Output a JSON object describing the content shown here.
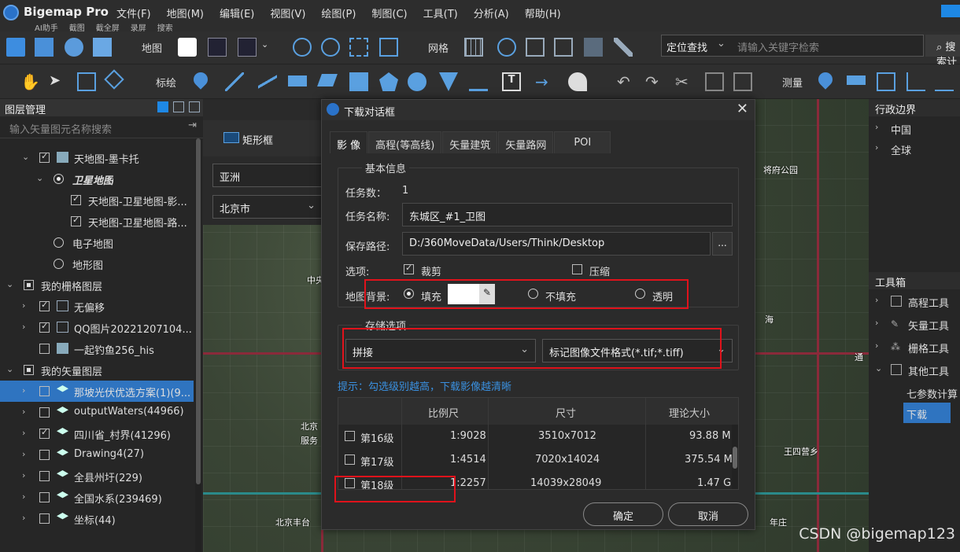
{
  "app": {
    "name": "Bigemap Pro",
    "menus": [
      "文件(F)",
      "地图(M)",
      "编辑(E)",
      "视图(V)",
      "绘图(P)",
      "制图(C)",
      "工具(T)",
      "分析(A)",
      "帮助(H)"
    ],
    "quick_tools": [
      "AI助手",
      "截图",
      "截全屏",
      "录屏",
      "搜索"
    ]
  },
  "toolbar1": {
    "map_label": "地图",
    "grid_label": "网格",
    "locate_select": "定位查找",
    "search_placeholder": "请输入关键字检索",
    "search_button": "搜索计算"
  },
  "toolbar2": {
    "draw_label": "标绘",
    "measure_label": "测量"
  },
  "left_panel": {
    "title": "图层管理",
    "filter_placeholder": "输入矢量图元名称搜索",
    "items": [
      {
        "label": "天地图-墨卡托"
      },
      {
        "label": "卫星地图"
      },
      {
        "label": "天地图-卫星地图-影..."
      },
      {
        "label": "天地图-卫星地图-路..."
      },
      {
        "label": "电子地图"
      },
      {
        "label": "地形图"
      },
      {
        "label": "我的栅格图层"
      },
      {
        "label": "无偏移"
      },
      {
        "label": "QQ图片20221207104..."
      },
      {
        "label": "一起钓鱼256_his"
      },
      {
        "label": "我的矢量图层"
      },
      {
        "label": "那坡光伏优选方案(1)(9..."
      },
      {
        "label": "outputWaters(44966)"
      },
      {
        "label": "四川省_村界(41296)"
      },
      {
        "label": "Drawing4(27)"
      },
      {
        "label": "全县州圩(229)"
      },
      {
        "label": "全国水系(239469)"
      },
      {
        "label": "坐标(44)"
      }
    ]
  },
  "select_panel": {
    "rect_label": "矩形框",
    "continent": "亚洲",
    "city": "北京市"
  },
  "map": {
    "labels": [
      "中央",
      "北京",
      "服务",
      "北京丰台",
      "将府公园",
      "王四营乡",
      "年庄",
      "海",
      "通"
    ]
  },
  "right_panel": {
    "admin_title": "行政边界",
    "admin_items": [
      "中国",
      "全球"
    ],
    "toolbox_title": "工具箱",
    "toolbox_items": [
      "高程工具",
      "矢量工具",
      "栅格工具",
      "其他工具",
      "七参数计算",
      "下载"
    ]
  },
  "dialog": {
    "title": "下载对话框",
    "tabs": [
      "影 像",
      "高程(等高线)",
      "矢量建筑",
      "矢量路网",
      "POI"
    ],
    "basic_group": "基本信息",
    "task_count_label": "任务数：",
    "task_count": "1",
    "task_name_label": "任务名称:",
    "task_name": "东城区_#1_卫图",
    "save_path_label": "保存路径:",
    "save_path": "D:/360MoveData/Users/Think/Desktop",
    "browse": "...",
    "options_label": "选项:",
    "crop_label": "裁剪",
    "compress_label": "压缩",
    "bg_label": "地图背景:",
    "bg_fill": "填充",
    "bg_nofill": "不填充",
    "bg_transparent": "透明",
    "storage_group": "存储选项",
    "storage_mode": "拼接",
    "file_format": "标记图像文件格式(*.tif;*.tiff)",
    "hint": "提示：勾选级别越高，下载影像越清晰",
    "table_headers": [
      "比例尺",
      "尺寸",
      "理论大小"
    ],
    "rows": [
      {
        "level": "第16级",
        "scale": "1:9028",
        "size": "3510x7012",
        "filesize": "93.88 M"
      },
      {
        "level": "第17级",
        "scale": "1:4514",
        "size": "7020x14024",
        "filesize": "375.54 M"
      },
      {
        "level": "第18级",
        "scale": "1:2257",
        "size": "14039x28049",
        "filesize": "1.47 G"
      }
    ],
    "ok": "确定",
    "cancel": "取消"
  },
  "watermark": "CSDN @bigemap123",
  "colors": {
    "accent": "#1e88e5",
    "highlight": "#e0121b",
    "selected": "#2f74c0"
  }
}
